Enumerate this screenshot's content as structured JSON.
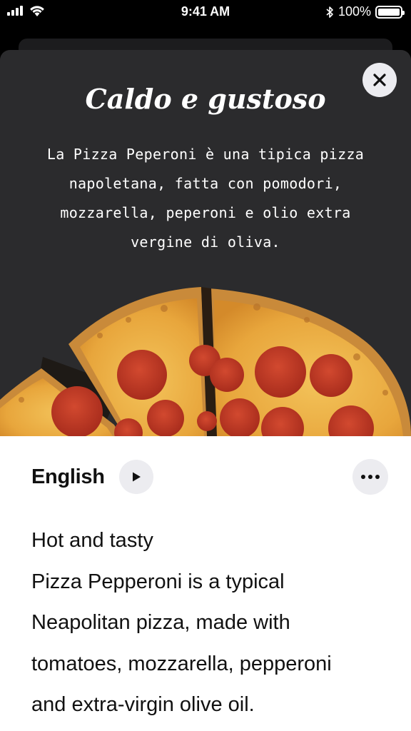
{
  "status_bar": {
    "time": "9:41 AM",
    "battery_percent": "100%",
    "battery_level": 1.0,
    "icons": [
      "signal-icon",
      "wifi-icon",
      "bluetooth-icon",
      "battery-icon"
    ]
  },
  "card": {
    "title": "Caldo e gustoso",
    "description": "La Pizza Peperoni è una tipica pizza napoletana, fatta con pomodori, mozzarella, peperoni e olio extra vergine di oliva.",
    "close_icon": "close-icon",
    "image": "pizza-pepperoni-image"
  },
  "translation_panel": {
    "language": "English",
    "play_icon": "play-icon",
    "more_icon": "more-horizontal-icon",
    "lines": [
      "Hot and tasty",
      "Pizza Pepperoni is a typical",
      "Neapolitan pizza, made with",
      "tomatoes, mozzarella, pepperoni",
      "and extra-virgin olive oil."
    ]
  },
  "colors": {
    "card_background": "#2b2b2d",
    "panel_background": "#ffffff",
    "button_background": "#ececf0"
  }
}
